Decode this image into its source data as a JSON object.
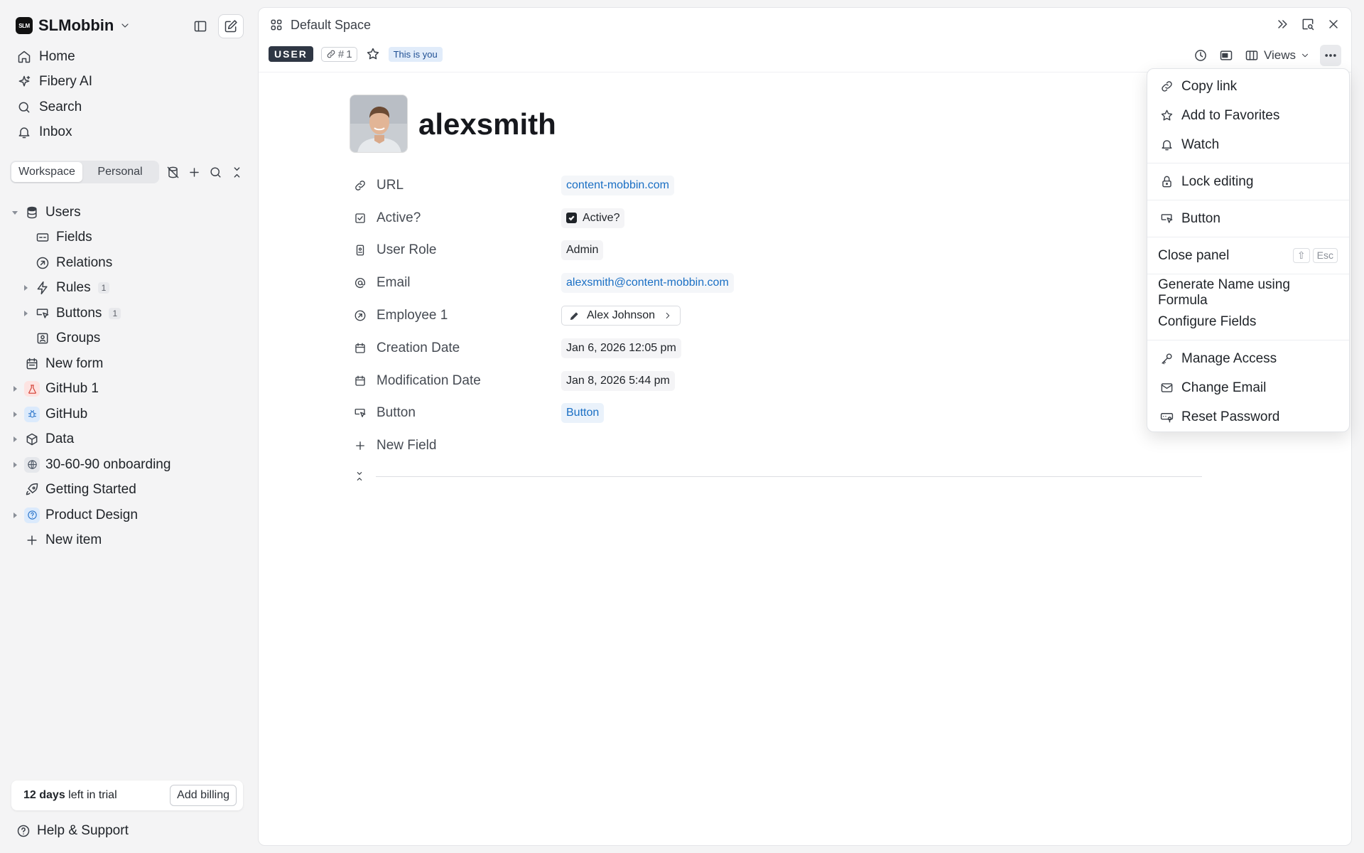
{
  "sidebar": {
    "workspace_name": "SLMobbin",
    "workspace_logo": "SLM",
    "nav": [
      {
        "label": "Home",
        "icon": "home-icon"
      },
      {
        "label": "Fibery AI",
        "icon": "sparkle-icon"
      },
      {
        "label": "Search",
        "icon": "search-icon"
      },
      {
        "label": "Inbox",
        "icon": "bell-icon"
      }
    ],
    "tabs": {
      "workspace": "Workspace",
      "personal": "Personal"
    },
    "tree": [
      {
        "label": "Users",
        "icon": "database-icon",
        "caret": "open",
        "indent": 0
      },
      {
        "label": "Fields",
        "icon": "fields-icon",
        "indent": 1
      },
      {
        "label": "Relations",
        "icon": "relations-icon",
        "indent": 1
      },
      {
        "label": "Rules",
        "icon": "bolt-icon",
        "caret": "closed",
        "badge": "1",
        "indent": 1
      },
      {
        "label": "Buttons",
        "icon": "cursor-button-icon",
        "caret": "closed",
        "badge": "1",
        "indent": 1
      },
      {
        "label": "Groups",
        "icon": "groups-icon",
        "indent": 1
      },
      {
        "label": "New form",
        "icon": "form-icon",
        "indent": 0
      },
      {
        "label": "GitHub 1",
        "icon": "flask-icon",
        "caret": "closed",
        "indent": 0
      },
      {
        "label": "GitHub",
        "icon": "bug-icon",
        "caret": "closed",
        "indent": 0
      },
      {
        "label": "Data",
        "icon": "box-icon",
        "caret": "closed",
        "indent": 0
      },
      {
        "label": "30-60-90 onboarding",
        "icon": "globe-icon",
        "caret": "closed",
        "indent": 0
      },
      {
        "label": "Getting Started",
        "icon": "rocket-icon",
        "indent": 0
      },
      {
        "label": "Product Design",
        "icon": "help-circle-icon",
        "caret": "closed",
        "indent": 0
      },
      {
        "label": "New item",
        "icon": "plus-icon",
        "indent": 0
      }
    ],
    "trial_days": "12 days",
    "trial_rest": " left in trial",
    "billing_label": "Add billing",
    "help_label": "Help & Support"
  },
  "panel": {
    "breadcrumb": "Default Space",
    "type_tag": "USER",
    "id_tag": "1",
    "you_tag": "This is you",
    "views_label": "Views",
    "title": "alexsmith",
    "fields": [
      {
        "label": "URL",
        "value": "content-mobbin.com",
        "kind": "link",
        "icon": "link-icon"
      },
      {
        "label": "Active?",
        "value": "Active?",
        "kind": "checkbox",
        "icon": "checkbox-icon"
      },
      {
        "label": "User Role",
        "value": "Admin",
        "kind": "text",
        "icon": "badge-icon"
      },
      {
        "label": "Email",
        "value": "alexsmith@content-mobbin.com",
        "kind": "link",
        "icon": "at-icon"
      },
      {
        "label": "Employee 1",
        "value": "Alex Johnson",
        "kind": "relation",
        "icon": "relation-icon"
      },
      {
        "label": "Creation Date",
        "value": "Jan 6, 2026 12:05 pm",
        "kind": "text",
        "icon": "calendar-icon"
      },
      {
        "label": "Modification Date",
        "value": "Jan 8, 2026 5:44 pm",
        "kind": "text",
        "icon": "calendar-icon"
      },
      {
        "label": "Button",
        "value": "Button",
        "kind": "button",
        "icon": "cursor-button-icon"
      }
    ],
    "new_field_label": "New Field"
  },
  "menu": {
    "items": [
      {
        "label": "Copy link",
        "icon": "link-icon"
      },
      {
        "label": "Add to Favorites",
        "icon": "star-icon"
      },
      {
        "label": "Watch",
        "icon": "bell-icon"
      },
      {
        "label": "Lock editing",
        "icon": "lock-icon"
      },
      {
        "label": "Button",
        "icon": "cursor-button-icon"
      },
      {
        "label": "Close panel",
        "shortcut": [
          "⇧",
          "Esc"
        ]
      },
      {
        "label": "Generate Name using Formula"
      },
      {
        "label": "Configure Fields"
      },
      {
        "label": "Manage Access",
        "icon": "key-icon"
      },
      {
        "label": "Change Email",
        "icon": "mail-icon"
      },
      {
        "label": "Reset Password",
        "icon": "password-icon"
      }
    ]
  },
  "colors": {
    "accent_link": "#1a6fc4",
    "tag_dark": "#2f3744",
    "you_bg": "#e1ecfa"
  }
}
